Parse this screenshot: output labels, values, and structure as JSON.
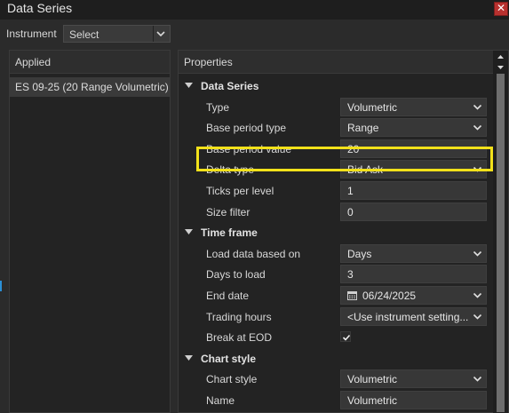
{
  "window": {
    "title": "Data Series",
    "close_label": "✕"
  },
  "instrument": {
    "label": "Instrument",
    "value": "Select"
  },
  "applied": {
    "header": "Applied",
    "items": [
      "ES 09-25 (20 Range Volumetric)"
    ]
  },
  "properties": {
    "header": "Properties",
    "sections": {
      "data_series": {
        "label": "Data Series",
        "rows": {
          "type": {
            "label": "Type",
            "value": "Volumetric"
          },
          "base_period_type": {
            "label": "Base period type",
            "value": "Range"
          },
          "base_period_value": {
            "label": "Base period value",
            "value": "20"
          },
          "delta_type": {
            "label": "Delta type",
            "value": "Bid Ask"
          },
          "ticks_per_level": {
            "label": "Ticks per level",
            "value": "1"
          },
          "size_filter": {
            "label": "Size filter",
            "value": "0"
          }
        }
      },
      "time_frame": {
        "label": "Time frame",
        "rows": {
          "load_data_based_on": {
            "label": "Load data based on",
            "value": "Days"
          },
          "days_to_load": {
            "label": "Days to load",
            "value": "3"
          },
          "end_date": {
            "label": "End date",
            "value": "06/24/2025"
          },
          "trading_hours": {
            "label": "Trading hours",
            "value": "<Use instrument setting..."
          },
          "break_at_eod": {
            "label": "Break at EOD",
            "checked": true
          }
        }
      },
      "chart_style": {
        "label": "Chart style",
        "rows": {
          "chart_style": {
            "label": "Chart style",
            "value": "Volumetric"
          },
          "name": {
            "label": "Name",
            "value": "Volumetric"
          }
        }
      }
    }
  },
  "colors": {
    "highlight": "#f2e11a",
    "close": "#b8312f"
  }
}
